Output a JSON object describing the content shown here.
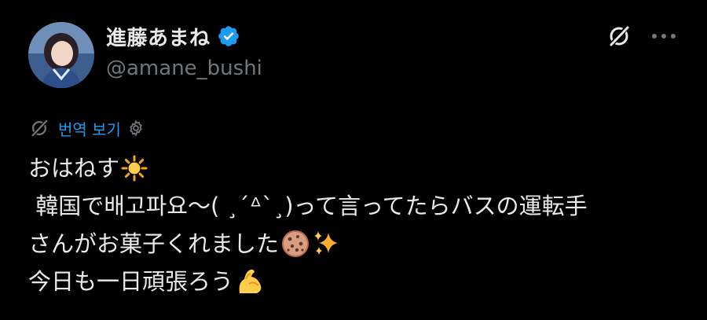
{
  "header": {
    "display_name": "進藤あまね",
    "handle": "@amane_bushi",
    "verified": true,
    "icons": {
      "avatar": "profile-photo",
      "verified": "verified-badge-icon",
      "grok": "grok-icon",
      "more": "more-options-icon"
    }
  },
  "translate": {
    "label": "번역 보기",
    "icons": {
      "translate": "grok-translate-icon",
      "settings": "gear-icon"
    }
  },
  "tweet": {
    "lines": [
      {
        "text": "おはねす",
        "emoji": "sun-emoji"
      },
      {
        "text": " 韓国で배고파요〜( ¸´ᐞ`¸)って言ってたらバスの運転手",
        "emoji": ""
      },
      {
        "text": "さんがお菓子くれました",
        "emoji": "cookie-emoji sparkles-emoji"
      },
      {
        "text": "今日も一日頑張ろう",
        "emoji": "flexed-biceps-emoji"
      }
    ]
  },
  "colors": {
    "background": "#000000",
    "text_primary": "#e7e9ea",
    "text_secondary": "#71767b",
    "accent": "#1d9bf0"
  }
}
